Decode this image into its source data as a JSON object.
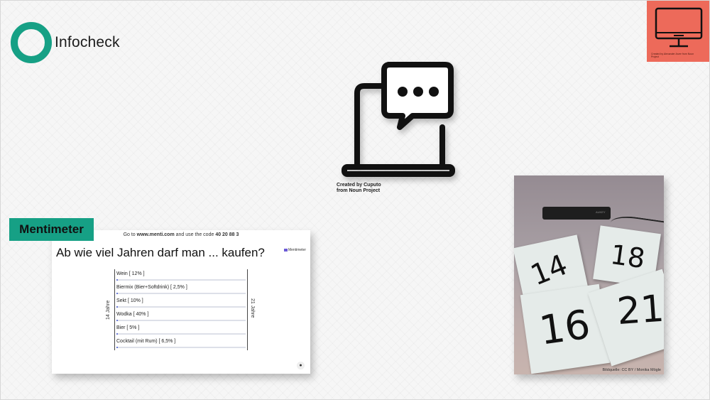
{
  "logo": {
    "text": "Infocheck",
    "color": "#16a085"
  },
  "top_right": {
    "icon": "monitor-icon",
    "color": "#ed6a5a",
    "credit": "Created by Alexander Arzer from Noun Project"
  },
  "laptop": {
    "icon": "laptop-chat-icon",
    "credit_line1": "Created by Cuputo",
    "credit_line2": "from Noun Project"
  },
  "mentimeter": {
    "label": "Mentimeter",
    "goto_prefix": "Go to",
    "goto_url": "www.menti.com",
    "goto_mid": "and use the code",
    "goto_code": "40 20 88 3",
    "brand": "Mentimeter",
    "question": "Ab wie viel Jahren darf man ... kaufen?",
    "left_age": "14 Jahre",
    "right_age": "21 Jahre",
    "options": [
      {
        "label": "Wein [ 12% ]",
        "value": 0
      },
      {
        "label": "Biermix (Bier+Softdrink) [ 2,5% ]",
        "value": 0
      },
      {
        "label": "Sekt [ 10% ]",
        "value": 0
      },
      {
        "label": "Wodka [ 40% ]",
        "value": 0
      },
      {
        "label": "Bier [ 5% ]",
        "value": 0
      },
      {
        "label": "Cocktail (mit Rum) [ 6,5% ]",
        "value": 0
      }
    ]
  },
  "photo": {
    "notes": [
      "14",
      "18",
      "16",
      "21"
    ],
    "camera_label": "AUKEY",
    "source": "Bildquelle: CC BY / Monika Mögle"
  }
}
